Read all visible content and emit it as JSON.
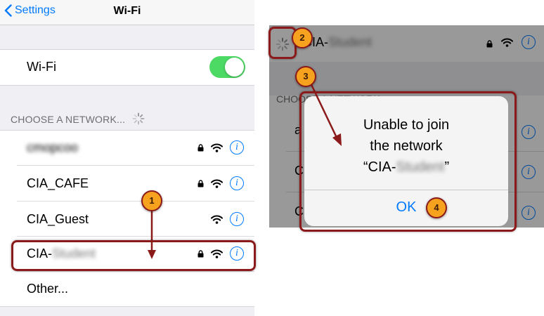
{
  "left_screen": {
    "nav": {
      "back_label": "Settings",
      "title": "Wi-Fi"
    },
    "wifi_toggle": {
      "label": "Wi-Fi",
      "state": "on",
      "on_color": "#4cd964"
    },
    "section_header": "CHOOSE A NETWORK...",
    "networks": [
      {
        "name": "cmopcoo",
        "obscured": true,
        "locked": true
      },
      {
        "name": "CIA_CAFE",
        "obscured": false,
        "locked": true
      },
      {
        "name": "CIA_Guest",
        "obscured": false,
        "locked": false
      },
      {
        "name": "CIA-",
        "name_suffix": "Student",
        "suffix_obscured": true,
        "locked": true
      }
    ],
    "other_label": "Other..."
  },
  "right_screen": {
    "top_row": {
      "name": "CIA-",
      "name_suffix": "Student",
      "suffix_obscured": true,
      "locked": true
    },
    "section_header": "CHOOSE A NETWORK",
    "background_rows": [
      "a",
      "C",
      "C"
    ],
    "alert": {
      "title_line1": "Unable to join",
      "title_line2": "the network",
      "title_line3_prefix": "“CIA-",
      "title_line3_obscured": "Student",
      "title_line3_suffix": "”",
      "ok_label": "OK"
    }
  },
  "callouts": [
    "1",
    "2",
    "3",
    "4"
  ],
  "annotation_color": "#8b1a1a",
  "badge_color": "#f6a21e"
}
